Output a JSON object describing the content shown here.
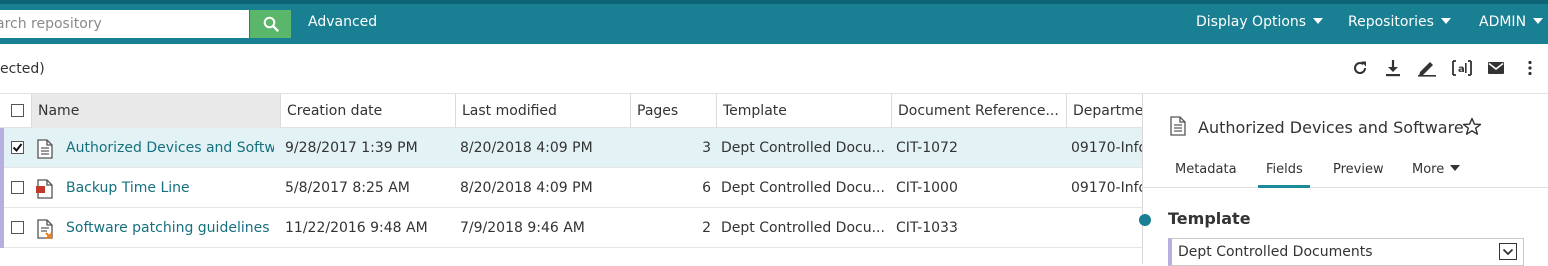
{
  "topbar": {
    "search_placeholder": "Search repository",
    "search_visible_text": "arch repository",
    "advanced_label": "Advanced",
    "display_options_label": "Display Options",
    "repositories_label": "Repositories",
    "admin_label": "ADMIN"
  },
  "toolbar": {
    "selection_status": "ected)"
  },
  "grid": {
    "columns": [
      "Name",
      "Creation date",
      "Last modified",
      "Pages",
      "Template",
      "Document Reference...",
      "Departme"
    ],
    "rows": [
      {
        "checked": true,
        "icon": "document-icon",
        "name": "Authorized Devices and Softw...",
        "created": "9/28/2017 1:39 PM",
        "modified": "8/20/2018 4:09 PM",
        "pages": "3",
        "template": "Dept Controlled Docu...",
        "docref": "CIT-1072",
        "department": "09170-Info"
      },
      {
        "checked": false,
        "icon": "pdf-document-icon",
        "name": "Backup Time Line",
        "created": "5/8/2017 8:25 AM",
        "modified": "8/20/2018 4:09 PM",
        "pages": "6",
        "template": "Dept Controlled Docu...",
        "docref": "CIT-1000",
        "department": "09170-Info"
      },
      {
        "checked": false,
        "icon": "checked-out-document-icon",
        "name": "Software patching guidelines",
        "created": "11/22/2016 9:48 AM",
        "modified": "7/9/2018 9:46 AM",
        "pages": "2",
        "template": "Dept Controlled Docu...",
        "docref": "CIT-1033",
        "department": ""
      }
    ]
  },
  "panel": {
    "title": "Authorized Devices and Software",
    "tabs": [
      "Metadata",
      "Fields",
      "Preview",
      "More"
    ],
    "active_tab": "Fields",
    "section_title": "Template",
    "template_value": "Dept Controlled Documents"
  },
  "colors": {
    "topbar": "#197f93",
    "search_button": "#5ab66b",
    "link": "#16707f",
    "selected_row": "#e3f2f5",
    "row_marker": "#b5b0de"
  }
}
